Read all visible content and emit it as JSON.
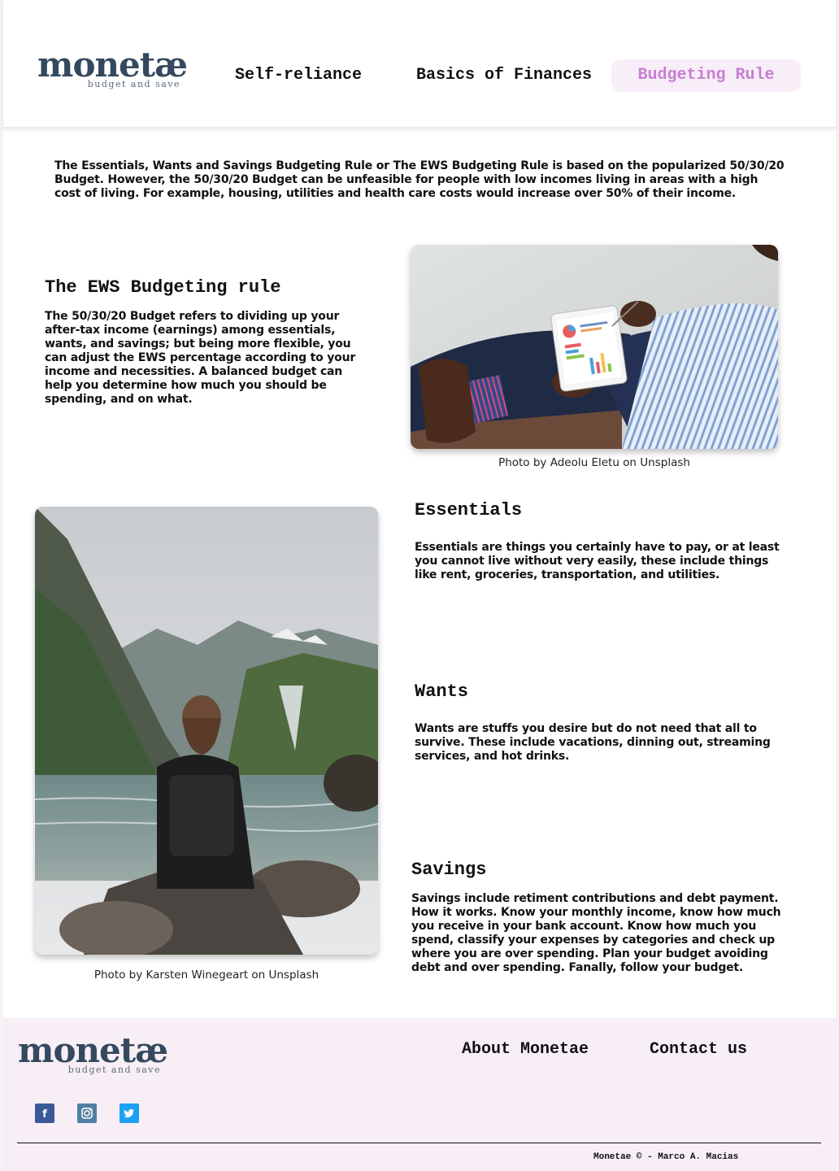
{
  "brand": {
    "name": "monetæ",
    "tagline": "budget and save"
  },
  "nav": {
    "items": [
      {
        "label": "Self-reliance"
      },
      {
        "label": "Basics of Finances"
      },
      {
        "label": "Budgeting Rule"
      }
    ],
    "active_index": 2,
    "active_color": "#c77ed0",
    "active_bg": "#f7eef8"
  },
  "intro": "The Essentials, Wants and Savings Budgeting Rule or The EWS Budgeting Rule is based on the popularized 50/30/20 Budget.  However, the 50/30/20 Budget can be unfeasible for people with low incomes living in areas with a high cost of living. For example, housing, utilities and health care costs would increase over 50% of their income.",
  "sections": {
    "ews": {
      "title": "The EWS Budgeting rule",
      "body": "The 50/30/20 Budget refers to dividing up your after-tax income (earnings) among essentials, wants, and savings; but being more flexible, you can adjust the EWS percentage according to your income and necessities. A balanced budget can help you determine how much you should be spending, and on what."
    },
    "essentials": {
      "title": "Essentials",
      "body": "Essentials are things you certainly have to pay, or at least you cannot live without very easily, these include things like rent, groceries, transportation, and utilities."
    },
    "wants": {
      "title": "Wants",
      "body": "Wants are stuffs you desire but do not need that all to survive. These include vacations, dinning out, streaming services, and hot drinks."
    },
    "savings": {
      "title": "Savings",
      "body": "Savings include retiment contributions and debt payment. How it works. Know your monthly income, know how much you receive in your bank account. Know how much you spend, classify your expenses by categories and check up where you are over spending. Plan your budget avoiding debt and over spending. Fanally, follow your budget."
    }
  },
  "photos": {
    "tablet": {
      "caption": "Photo by Adeolu Eletu on Unsplash"
    },
    "lake": {
      "caption": "Photo by Karsten Winegeart on Unsplash"
    }
  },
  "footer": {
    "links": {
      "about": "About Monetae",
      "contact": "Contact us"
    },
    "social": {
      "facebook": "f",
      "instagram": "◘",
      "twitter": "🐦"
    },
    "social_icons": [
      "facebook-icon",
      "instagram-icon",
      "twitter-icon"
    ],
    "copyright": "Monetae © - Marco A. Macias"
  }
}
